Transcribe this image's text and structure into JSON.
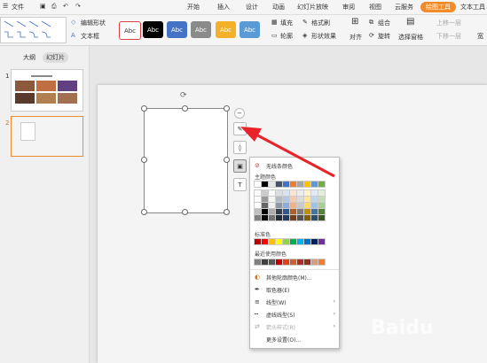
{
  "menubar": {
    "file": "文件",
    "tabs": [
      "开始",
      "插入",
      "设计",
      "动画",
      "幻灯片放映",
      "审阅",
      "视图",
      "云服务"
    ],
    "active_tab": "绘图工具",
    "last_tab": "文本工具"
  },
  "ribbon": {
    "edit_shape": "编辑形状",
    "text_box": "文本框",
    "style_label": "Abc",
    "fill": "填充",
    "outline": "轮廓",
    "format_brush": "格式刷",
    "shape_effect": "形状效果",
    "align": "对齐",
    "rotate": "旋转",
    "group": "组合",
    "select_pane": "选择窗格",
    "bring_forward": "上移一层",
    "send_backward": "下移一层",
    "wide": "宽"
  },
  "left_panel": {
    "tab_outline": "大纲",
    "tab_slides": "幻灯片",
    "slide1_num": "1",
    "slide2_num": "2"
  },
  "outline_menu": {
    "no_line": "无线条颜色",
    "theme_colors": "主题颜色",
    "standard_colors": "标准色",
    "recent_colors": "最近使用颜色",
    "more_colors": "其他轮廓颜色(M)...",
    "eyedropper": "取色器(E)",
    "line_style": "线型(W)",
    "dash_style": "虚线线型(S)",
    "arrow_style": "箭头样式(R)",
    "more_settings": "更多设置(O)..."
  },
  "colors": {
    "accent": "#f28c2a",
    "arrow": "#e8232a",
    "theme_top": [
      "#ffffff",
      "#000000",
      "#e7e6e6",
      "#44546a",
      "#4472c4",
      "#ed7d31",
      "#a5a5a5",
      "#ffc000",
      "#5b9bd5",
      "#70ad47"
    ],
    "standard": [
      "#c00000",
      "#ff0000",
      "#ffc000",
      "#ffff00",
      "#92d050",
      "#00b050",
      "#00b0f0",
      "#0070c0",
      "#002060",
      "#7030a0"
    ],
    "recent": [
      "#808080",
      "#404040",
      "#595959",
      "#c00000",
      "#e04020",
      "#d06030",
      "#b03020",
      "#903020",
      "#d0a080",
      "#f08030"
    ]
  }
}
